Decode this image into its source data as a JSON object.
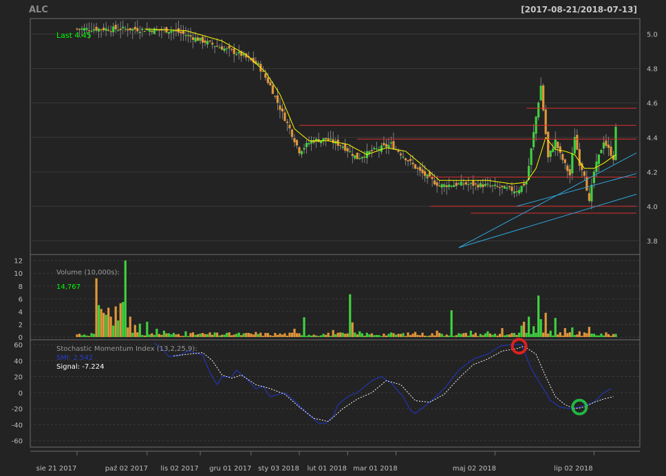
{
  "header": {
    "symbol": "ALC",
    "date_range": "[2017-08-21/2018-07-13]"
  },
  "colors": {
    "background": "#232323",
    "panel_border": "#6f6f6f",
    "grid": "#3a3a3a",
    "axis_text": "#bfbfbf",
    "up_candle": "#3fd03f",
    "down_candle": "#e0963a",
    "sma_line": "#ffff00",
    "support_lines": "#e03030",
    "trend_lines": "#2ea8e0",
    "smi_line": "#2233aa",
    "signal_line": "#ffffff",
    "last_label": "#00ff00",
    "marker_red": "#e02020",
    "marker_green": "#22b844"
  },
  "x_axis": {
    "ticks": [
      {
        "label": "sie 21 2017",
        "index": 0
      },
      {
        "label": "paź 02 2017",
        "index": 29
      },
      {
        "label": "lis 02 2017",
        "index": 51
      },
      {
        "label": "gru 01 2017",
        "index": 72
      },
      {
        "label": "sty 03 2018",
        "index": 92
      },
      {
        "label": "lut 01 2018",
        "index": 112
      },
      {
        "label": "mar 01 2018",
        "index": 132
      },
      {
        "label": "maj 02 2018",
        "index": 173
      },
      {
        "label": "lip 02 2018",
        "index": 214
      }
    ]
  },
  "price_panel": {
    "last_label": "Last 4.45",
    "y_ticks": [
      "3.8",
      "4.0",
      "4.2",
      "4.4",
      "4.6",
      "4.8",
      "5.0"
    ],
    "ylim": [
      3.72,
      5.09
    ]
  },
  "volume_panel": {
    "title": "Volume (10,000s):",
    "value": "14,767",
    "y_ticks": [
      "0",
      "2",
      "4",
      "6",
      "8",
      "10",
      "12"
    ],
    "ylim": [
      0,
      12.5
    ]
  },
  "smi_panel": {
    "title": "Stochastic Momentum Index (13,2,25,9):",
    "smi_label": "SMI: 2.542",
    "signal_label": "Signal: -7.224",
    "y_ticks": [
      "-60",
      "-40",
      "-20",
      "0",
      "20",
      "40",
      "60"
    ],
    "ylim": [
      -68,
      66
    ]
  },
  "chart_data": {
    "type": "candlestick",
    "symbol": "ALC",
    "period": "2017-08-21 to 2018-07-13",
    "last_close": 4.45,
    "n_bars": 224,
    "close_keypoints": [
      [
        0,
        5.03
      ],
      [
        20,
        5.03
      ],
      [
        40,
        5.02
      ],
      [
        50,
        4.97
      ],
      [
        60,
        4.92
      ],
      [
        68,
        4.88
      ],
      [
        75,
        4.82
      ],
      [
        80,
        4.7
      ],
      [
        84,
        4.57
      ],
      [
        88,
        4.45
      ],
      [
        92,
        4.32
      ],
      [
        97,
        4.38
      ],
      [
        103,
        4.39
      ],
      [
        110,
        4.35
      ],
      [
        116,
        4.28
      ],
      [
        122,
        4.32
      ],
      [
        130,
        4.36
      ],
      [
        136,
        4.28
      ],
      [
        142,
        4.2
      ],
      [
        150,
        4.12
      ],
      [
        160,
        4.13
      ],
      [
        170,
        4.12
      ],
      [
        182,
        4.09
      ],
      [
        186,
        4.14
      ],
      [
        190,
        4.52
      ],
      [
        192,
        4.7
      ],
      [
        195,
        4.28
      ],
      [
        198,
        4.38
      ],
      [
        200,
        4.3
      ],
      [
        204,
        4.18
      ],
      [
        206,
        4.41
      ],
      [
        208,
        4.25
      ],
      [
        210,
        4.19
      ],
      [
        212,
        4.02
      ],
      [
        214,
        4.2
      ],
      [
        218,
        4.38
      ],
      [
        222,
        4.28
      ],
      [
        223,
        4.45
      ]
    ],
    "sma_keypoints": [
      [
        28,
        5.03
      ],
      [
        45,
        5.02
      ],
      [
        60,
        4.96
      ],
      [
        70,
        4.88
      ],
      [
        78,
        4.78
      ],
      [
        84,
        4.65
      ],
      [
        90,
        4.45
      ],
      [
        96,
        4.38
      ],
      [
        104,
        4.38
      ],
      [
        112,
        4.36
      ],
      [
        120,
        4.3
      ],
      [
        128,
        4.34
      ],
      [
        136,
        4.32
      ],
      [
        142,
        4.25
      ],
      [
        150,
        4.15
      ],
      [
        160,
        4.15
      ],
      [
        170,
        4.15
      ],
      [
        180,
        4.13
      ],
      [
        186,
        4.14
      ],
      [
        190,
        4.22
      ],
      [
        194,
        4.4
      ],
      [
        198,
        4.33
      ],
      [
        202,
        4.32
      ],
      [
        206,
        4.3
      ],
      [
        210,
        4.22
      ],
      [
        214,
        4.22
      ],
      [
        218,
        4.25
      ],
      [
        223,
        4.3
      ]
    ],
    "support_levels": [
      {
        "value": 4.57,
        "from_index": 186
      },
      {
        "value": 4.47,
        "from_index": 92
      },
      {
        "value": 4.39,
        "from_index": 116
      },
      {
        "value": 4.17,
        "from_index": 144
      },
      {
        "value": 4.0,
        "from_index": 146
      },
      {
        "value": 3.96,
        "from_index": 163
      }
    ],
    "trend_lines": [
      {
        "from": [
          158,
          3.76
        ],
        "to": [
          224,
          4.31
        ]
      },
      {
        "from": [
          158,
          3.76
        ],
        "to": [
          224,
          4.07
        ]
      },
      {
        "from": [
          182,
          4.0
        ],
        "to": [
          224,
          4.19
        ]
      }
    ],
    "volume_spikes": [
      [
        8,
        9.2
      ],
      [
        9,
        5.0
      ],
      [
        10,
        4.4
      ],
      [
        11,
        3.8
      ],
      [
        12,
        3.5
      ],
      [
        13,
        4.6
      ],
      [
        14,
        3.2
      ],
      [
        15,
        1.8
      ],
      [
        16,
        4.8
      ],
      [
        17,
        2.6
      ],
      [
        18,
        5.3
      ],
      [
        19,
        5.5
      ],
      [
        20,
        12.0
      ],
      [
        21,
        1.5
      ],
      [
        22,
        3.2
      ],
      [
        24,
        1.9
      ],
      [
        26,
        2.1
      ],
      [
        29,
        2.4
      ],
      [
        33,
        1.3
      ],
      [
        36,
        1.0
      ],
      [
        45,
        0.9
      ],
      [
        58,
        0.7
      ],
      [
        74,
        0.8
      ],
      [
        90,
        1.3
      ],
      [
        94,
        3.1
      ],
      [
        106,
        1.1
      ],
      [
        113,
        6.7
      ],
      [
        114,
        2.3
      ],
      [
        117,
        0.9
      ],
      [
        140,
        0.8
      ],
      [
        149,
        1.0
      ],
      [
        155,
        4.2
      ],
      [
        163,
        1.0
      ],
      [
        170,
        0.9
      ],
      [
        176,
        1.4
      ],
      [
        184,
        1.8
      ],
      [
        185,
        2.4
      ],
      [
        187,
        3.2
      ],
      [
        189,
        1.7
      ],
      [
        191,
        6.5
      ],
      [
        192,
        2.8
      ],
      [
        194,
        3.8
      ],
      [
        196,
        1.0
      ],
      [
        198,
        3.0
      ],
      [
        202,
        1.4
      ],
      [
        205,
        1.5
      ],
      [
        208,
        0.9
      ],
      [
        212,
        1.6
      ]
    ],
    "volume_colors_note": "green = up bar, orange = down bar",
    "smi_keypoints": [
      [
        32,
        62
      ],
      [
        35,
        55
      ],
      [
        38,
        45
      ],
      [
        42,
        46
      ],
      [
        46,
        52
      ],
      [
        52,
        47
      ],
      [
        55,
        25
      ],
      [
        58,
        10
      ],
      [
        60,
        20
      ],
      [
        64,
        20
      ],
      [
        66,
        28
      ],
      [
        70,
        18
      ],
      [
        74,
        5
      ],
      [
        77,
        8
      ],
      [
        80,
        -5
      ],
      [
        86,
        0
      ],
      [
        90,
        -10
      ],
      [
        95,
        -25
      ],
      [
        100,
        -38
      ],
      [
        103,
        -38
      ],
      [
        106,
        -30
      ],
      [
        108,
        -15
      ],
      [
        112,
        -5
      ],
      [
        116,
        0
      ],
      [
        122,
        15
      ],
      [
        126,
        20
      ],
      [
        130,
        12
      ],
      [
        135,
        -5
      ],
      [
        138,
        -22
      ],
      [
        140,
        -26
      ],
      [
        146,
        -12
      ],
      [
        152,
        5
      ],
      [
        158,
        28
      ],
      [
        164,
        42
      ],
      [
        170,
        48
      ],
      [
        175,
        58
      ],
      [
        180,
        60
      ],
      [
        184,
        60
      ],
      [
        188,
        30
      ],
      [
        192,
        10
      ],
      [
        196,
        -10
      ],
      [
        200,
        -18
      ],
      [
        204,
        -20
      ],
      [
        208,
        -18
      ],
      [
        214,
        -12
      ],
      [
        218,
        0
      ],
      [
        221,
        5
      ]
    ],
    "signal_keypoints": [
      [
        40,
        46
      ],
      [
        46,
        48
      ],
      [
        52,
        50
      ],
      [
        56,
        40
      ],
      [
        60,
        22
      ],
      [
        64,
        18
      ],
      [
        68,
        22
      ],
      [
        74,
        10
      ],
      [
        80,
        5
      ],
      [
        86,
        -2
      ],
      [
        92,
        -18
      ],
      [
        98,
        -32
      ],
      [
        104,
        -36
      ],
      [
        110,
        -20
      ],
      [
        116,
        -8
      ],
      [
        122,
        0
      ],
      [
        128,
        15
      ],
      [
        134,
        10
      ],
      [
        140,
        -10
      ],
      [
        146,
        -12
      ],
      [
        152,
        -2
      ],
      [
        158,
        18
      ],
      [
        164,
        35
      ],
      [
        170,
        42
      ],
      [
        176,
        52
      ],
      [
        182,
        55
      ],
      [
        185,
        58
      ],
      [
        190,
        48
      ],
      [
        194,
        20
      ],
      [
        198,
        -5
      ],
      [
        202,
        -15
      ],
      [
        206,
        -20
      ],
      [
        210,
        -18
      ],
      [
        214,
        -12
      ],
      [
        218,
        -8
      ],
      [
        222,
        -5
      ]
    ],
    "markers": [
      {
        "panel": "smi",
        "index": 183,
        "value": 58,
        "color": "red",
        "shape": "circle"
      },
      {
        "panel": "smi",
        "index": 208,
        "value": -18,
        "color": "green",
        "shape": "circle"
      }
    ]
  }
}
